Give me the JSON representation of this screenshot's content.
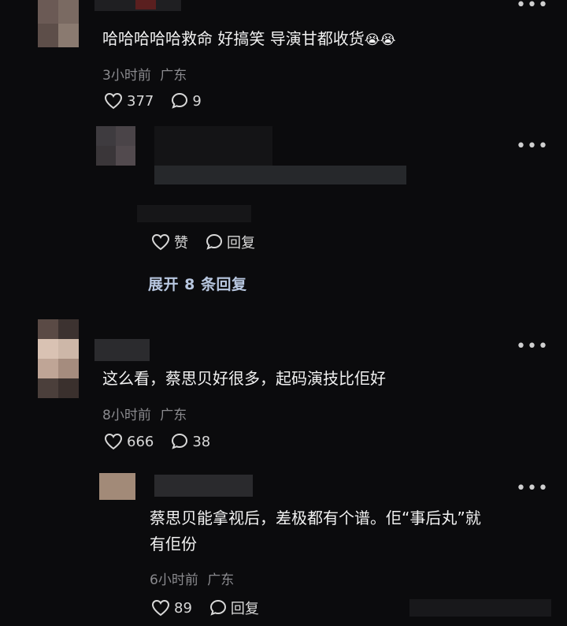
{
  "comments": [
    {
      "text": "哈哈哈哈哈救命 好搞笑 导演甘都收货",
      "emoji": "😭😭",
      "time": "3小时前",
      "location": "广东",
      "likes": "377",
      "replies": "9"
    },
    {
      "like_label": "赞",
      "reply_label": "回复",
      "expand": "展开 8 条回复"
    },
    {
      "text": "这么看，蔡思贝好很多，起码演技比佢好",
      "time": "8小时前",
      "location": "广东",
      "likes": "666",
      "replies": "38"
    },
    {
      "text_line1": "蔡思贝能拿视后，差极都有个谱。佢“事后丸”就",
      "text_line2": "有佢份",
      "time": "6小时前",
      "location": "广东",
      "likes": "89",
      "reply_label": "回复"
    }
  ],
  "icons": {
    "more": "more-dots-icon",
    "like": "heart-icon",
    "reply": "speech-bubble-icon"
  },
  "colors": {
    "background": "#0b0b0d",
    "meta": "#8a8a8e",
    "expand_link": "#b8c7e0"
  }
}
